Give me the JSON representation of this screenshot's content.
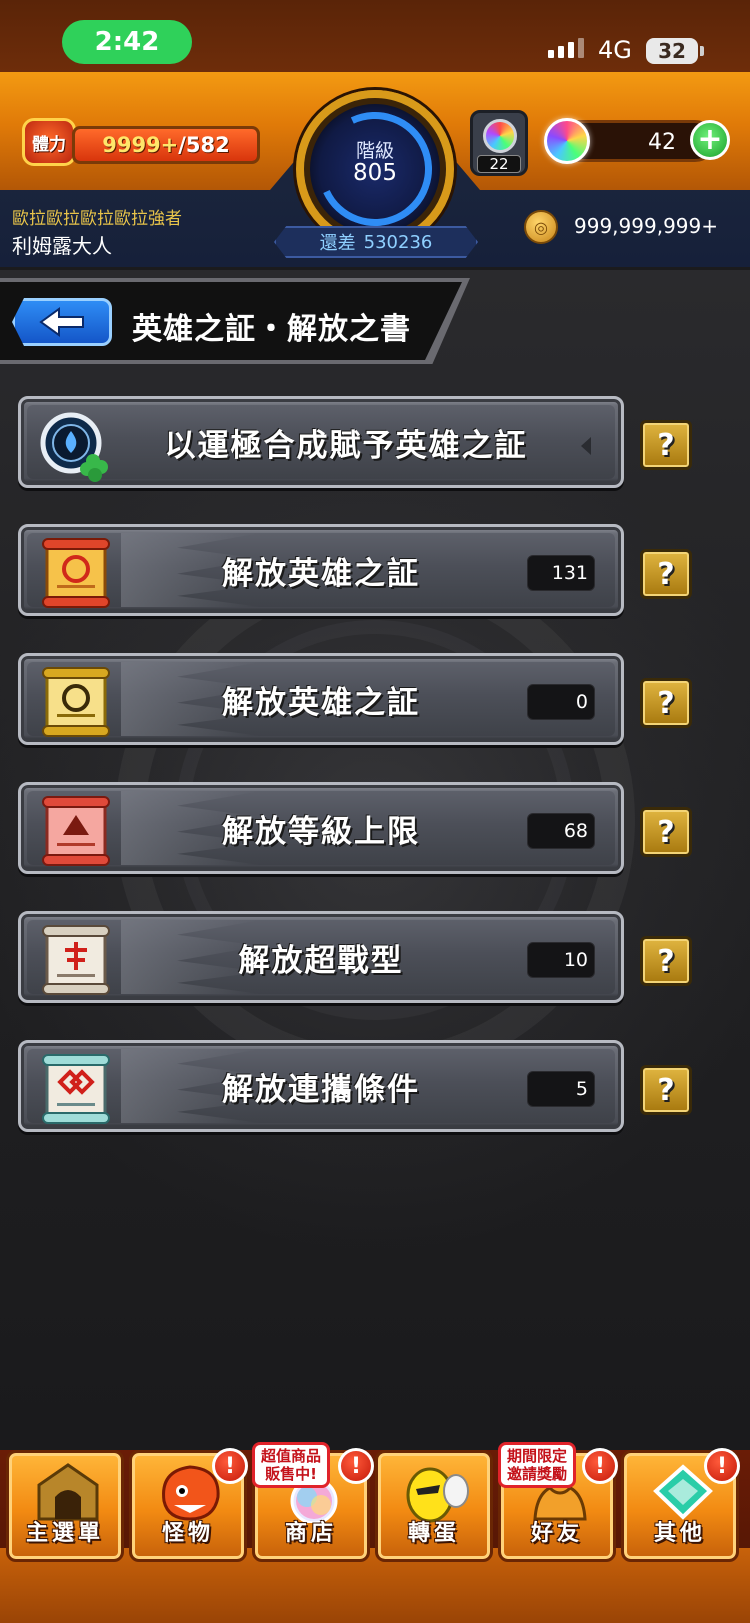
{
  "status_bar": {
    "time": "2:42",
    "network": "4G",
    "battery": "32"
  },
  "header": {
    "stamina_label": "體力",
    "stamina_current": "9999+",
    "stamina_max": "/582",
    "stamina_fill_fraction": 1.0,
    "rank_label": "階級",
    "rank_value": "805",
    "rank_remaining_label": "還差",
    "rank_remaining_value": "530236",
    "player_title": "歐拉歐拉歐拉歐拉強者",
    "player_name": "利姆露大人",
    "orb_box_count": "22",
    "orb_count": "42",
    "gold": "999,999,999+"
  },
  "page": {
    "title": "英雄之証・解放之書"
  },
  "rows": [
    {
      "label": "以運極合成賦予英雄之証",
      "count": null
    },
    {
      "label": "解放英雄之証",
      "count": "131"
    },
    {
      "label": "解放英雄之証",
      "count": "0"
    },
    {
      "label": "解放等級上限",
      "count": "68"
    },
    {
      "label": "解放超戰型",
      "count": "10"
    },
    {
      "label": "解放連攜條件",
      "count": "5"
    }
  ],
  "help_label": "?",
  "bottom_nav": [
    {
      "label": "主選單",
      "badge": null,
      "promo": null
    },
    {
      "label": "怪物",
      "badge": "!",
      "promo": null
    },
    {
      "label": "商店",
      "badge": "!",
      "promo": "超值商品\n販售中!"
    },
    {
      "label": "轉蛋",
      "badge": null,
      "promo": null
    },
    {
      "label": "好友",
      "badge": "!",
      "promo": "期間限定\n邀請獎勵"
    },
    {
      "label": "其他",
      "badge": "!",
      "promo": null
    }
  ],
  "colors": {
    "accent_orange": "#f28a12",
    "rank_blue": "#2f8df5",
    "help_gold": "#e0b540"
  }
}
